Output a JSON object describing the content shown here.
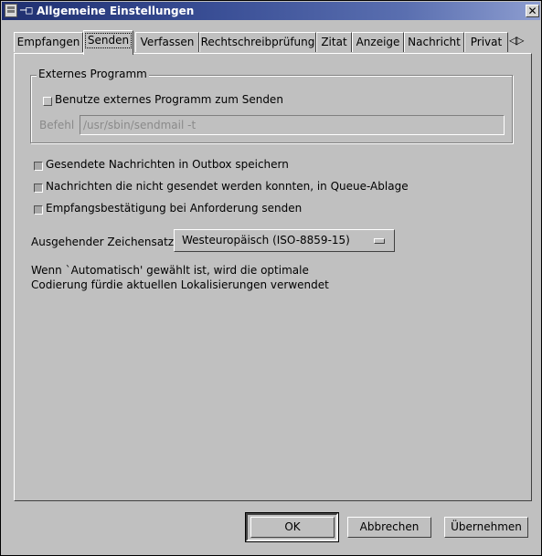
{
  "window": {
    "title": "Allgemeine Einstellungen",
    "pin_glyph": "─□",
    "close_glyph": "✕"
  },
  "tabs": [
    {
      "label": "Empfangen",
      "active": false
    },
    {
      "label": "Senden",
      "active": true
    },
    {
      "label": "Verfassen",
      "active": false
    },
    {
      "label": "Rechtschreibprüfung",
      "active": false
    },
    {
      "label": "Zitat",
      "active": false
    },
    {
      "label": "Anzeige",
      "active": false
    },
    {
      "label": "Nachricht",
      "active": false
    },
    {
      "label": "Privat",
      "active": false
    }
  ],
  "tab_scroll_glyphs": "◁▷",
  "external_program": {
    "group_title": "Externes Programm",
    "use_external_label": "Benutze externes Programm zum Senden",
    "use_external_checked": false,
    "command_label": "Befehl",
    "command_value": "/usr/sbin/sendmail -t"
  },
  "options": [
    {
      "label": "Gesendete Nachrichten in Outbox speichern",
      "checked": true
    },
    {
      "label": "Nachrichten die nicht gesendet werden konnten, in Queue-Ablage",
      "checked": true
    },
    {
      "label": "Empfangsbestätigung bei Anforderung senden",
      "checked": true
    }
  ],
  "charset": {
    "label": "Ausgehender Zeichensatz",
    "selected": "Westeuropäisch (ISO-8859-15)"
  },
  "info_lines": [
    "Wenn `Automatisch' gewählt ist, wird die optimale",
    "Codierung fürdie aktuellen Lokalisierungen verwendet"
  ],
  "buttons": {
    "ok": "OK",
    "cancel": "Abbrechen",
    "apply": "Übernehmen"
  }
}
